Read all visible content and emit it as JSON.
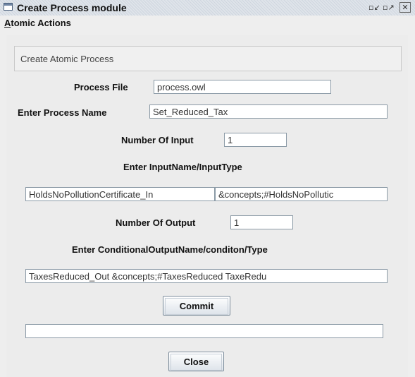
{
  "window": {
    "title": "Create Process module",
    "controls": {
      "minimize": "▫ʲ",
      "maximize": "▫ʳ",
      "close": "✕"
    }
  },
  "menu": {
    "items": [
      {
        "mnemonic": "A",
        "rest": "tomic Actions"
      }
    ]
  },
  "form": {
    "header": "Create Atomic Process",
    "process_file_label": "Process File",
    "process_file_value": "process.owl",
    "process_name_label": "Enter Process Name",
    "process_name_value": "Set_Reduced_Tax",
    "num_input_label": "Number Of Input",
    "num_input_value": "1",
    "input_header": "Enter InputName/InputType",
    "input_name_value": "HoldsNoPollutionCertificate_In",
    "input_type_value": "&concepts;#HoldsNoPollutic",
    "num_output_label": "Number Of Output",
    "num_output_value": "1",
    "output_header": "Enter ConditionalOutputName/conditon/Type",
    "output_value": "TaxesReduced_Out  &concepts;#TaxesReduced TaxeRedu",
    "commit_label": "Commit",
    "status_value": "",
    "close_label": "Close"
  }
}
